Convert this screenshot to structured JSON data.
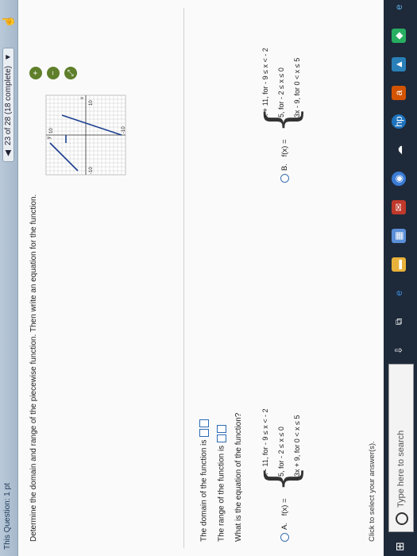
{
  "question_bar": {
    "title": "This Question: 1 pt",
    "progress": "23 of 28 (18 complete)",
    "prev_arrow": "◀",
    "next_arrow": "▼"
  },
  "instruction": "Determine the domain and range of the piecewise function. Then write an equation for the function.",
  "graph": {
    "x_min": -10,
    "x_max": 10,
    "y_min": -10,
    "y_max": 10,
    "labels": {
      "y_top": "10",
      "y_bottom": "-10",
      "x_left": "-10",
      "x_right": "10",
      "x_axis": "x",
      "y_axis": "y"
    }
  },
  "questions": {
    "domain": "The domain of the function is",
    "range": "The range of the function is",
    "equation": "What is the equation of the function?"
  },
  "options": {
    "A": {
      "label": "A.",
      "lhs": "f(x) =",
      "cases": [
        "x - 11, for  - 9 ≤ x < - 2",
        "5, for  - 2 ≤ x ≤ 0",
        "3x + 9, for 0 < x ≤ 5"
      ]
    },
    "B": {
      "label": "B.",
      "lhs": "f(x) =",
      "cases": [
        "x + 11, for  - 9 ≤ x < - 2",
        "5, for  - 2 ≤ x ≤ 0",
        "3x - 9, for 0 < x ≤ 5"
      ]
    }
  },
  "hint": "Click to select your answer(s).",
  "taskbar": {
    "search_placeholder": "Type here to search"
  }
}
